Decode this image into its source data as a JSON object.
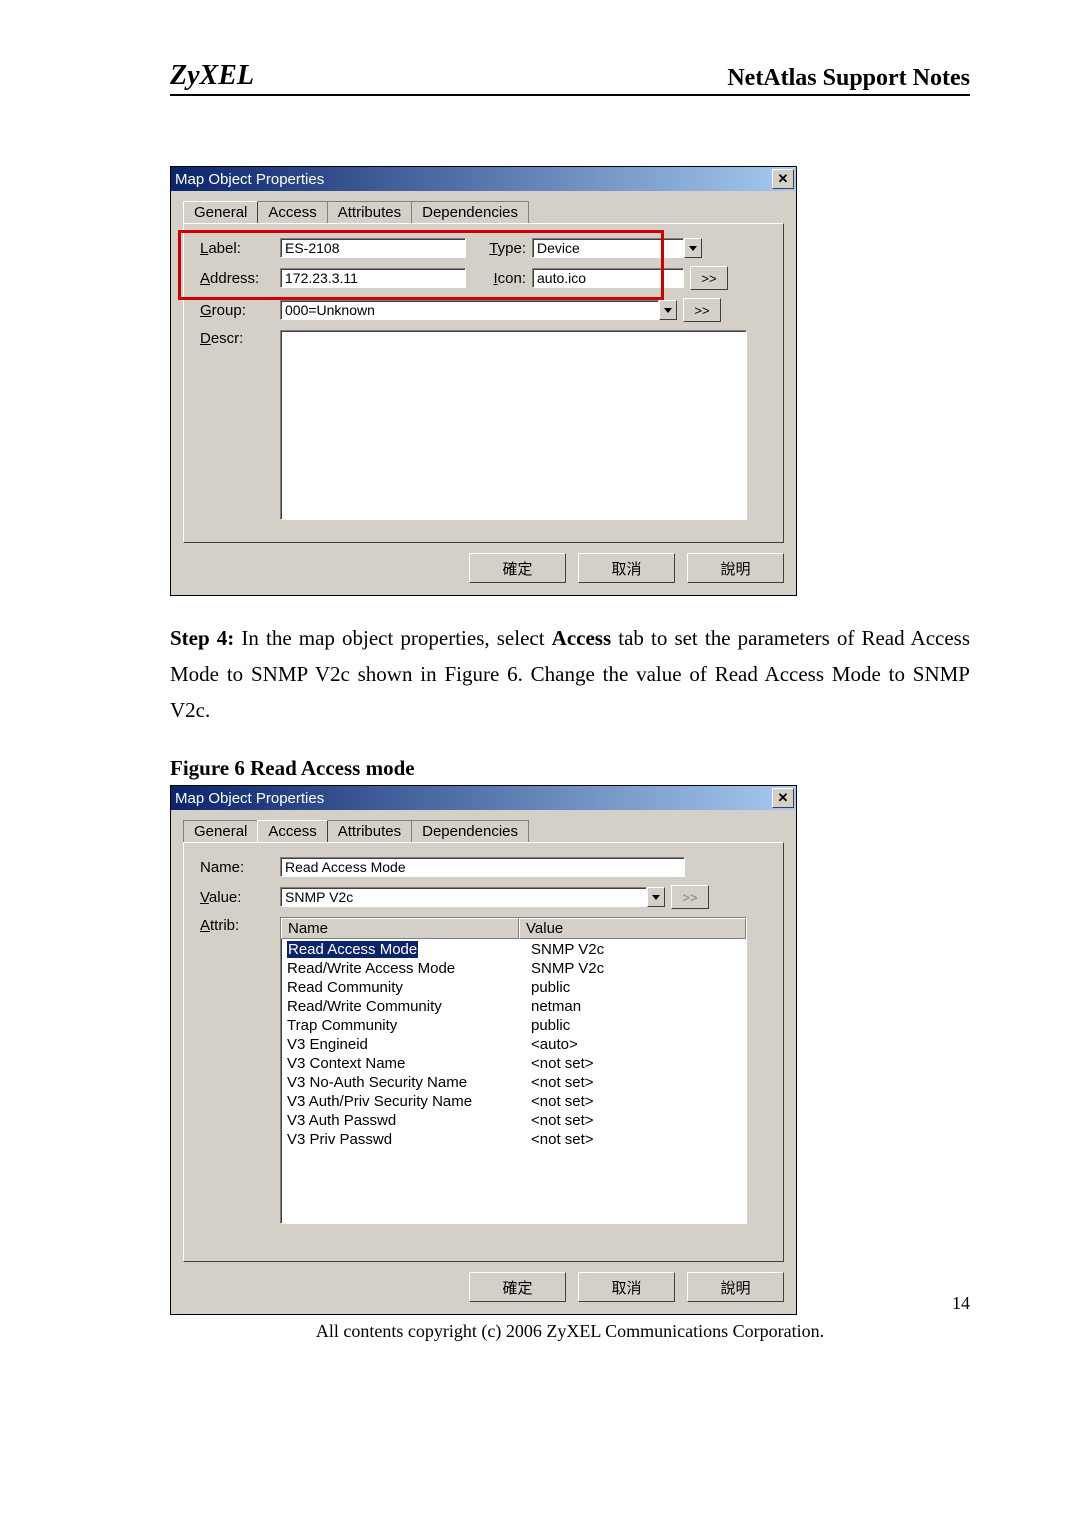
{
  "header": {
    "brand": "ZyXEL",
    "doc_title": "NetAtlas Support Notes"
  },
  "dialog1": {
    "title": "Map Object Properties",
    "tabs": [
      "General",
      "Access",
      "Attributes",
      "Dependencies"
    ],
    "active_tab": "General",
    "labels": {
      "label": "Label:",
      "label_k": "L",
      "address": "Address:",
      "address_k": "A",
      "type": "Type:",
      "type_k": "T",
      "icon": "Icon:",
      "icon_k": "I",
      "group": "Group:",
      "group_k": "G",
      "descr": "Descr:",
      "descr_k": "D"
    },
    "values": {
      "label": "ES-2108",
      "address": "172.23.3.11",
      "type": "Device",
      "icon": "auto.ico",
      "group": "000=Unknown"
    },
    "buttons": {
      "ok": "確定",
      "cancel": "取消",
      "help": "說明",
      "more": ">>"
    }
  },
  "step4_text_parts": {
    "prefix": "Step 4:",
    "body1": " In the map object properties, select ",
    "bold1": "Access",
    "body2": " tab to set the parameters of Read Access Mode to SNMP V2c shown in Figure 6. Change the value of Read Access Mode to SNMP V2c."
  },
  "figure6_caption": "Figure 6 Read Access mode",
  "dialog2": {
    "title": "Map Object Properties",
    "tabs": [
      "General",
      "Access",
      "Attributes",
      "Dependencies"
    ],
    "active_tab": "Access",
    "labels": {
      "name": "Name:",
      "name_k": "N",
      "value": "Value:",
      "value_k": "V",
      "attrib": "Attrib:",
      "attrib_k": "A"
    },
    "values": {
      "name": "Read Access Mode",
      "value": "SNMP V2c"
    },
    "attrib_headers": {
      "name": "Name",
      "value": "Value"
    },
    "attribs": [
      {
        "name": "Read Access Mode",
        "value": "SNMP V2c",
        "selected": true
      },
      {
        "name": "Read/Write Access Mode",
        "value": "SNMP V2c"
      },
      {
        "name": "Read Community",
        "value": "public"
      },
      {
        "name": "Read/Write Community",
        "value": "netman"
      },
      {
        "name": "Trap Community",
        "value": "public"
      },
      {
        "name": "V3 Engineid",
        "value": "<auto>"
      },
      {
        "name": "V3 Context Name",
        "value": "<not set>"
      },
      {
        "name": "V3 No-Auth Security Name",
        "value": "<not set>"
      },
      {
        "name": "V3 Auth/Priv Security Name",
        "value": "<not set>"
      },
      {
        "name": "V3 Auth Passwd",
        "value": "<not set>"
      },
      {
        "name": "V3 Priv Passwd",
        "value": "<not set>"
      }
    ],
    "buttons": {
      "ok": "確定",
      "cancel": "取消",
      "help": "說明",
      "more": ">>"
    }
  },
  "page_number": "14",
  "footer": "All contents copyright (c) 2006 ZyXEL Communications Corporation."
}
